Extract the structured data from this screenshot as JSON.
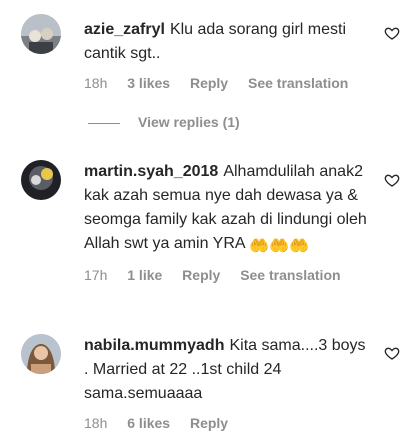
{
  "comments": [
    {
      "username": "azie_zafryl",
      "text": "Klu ada sorang girl mesti cantik sgt..",
      "time": "18h",
      "likes": "3 likes",
      "reply_label": "Reply",
      "translate_label": "See translation",
      "avatar_icon": "profile-photo"
    },
    {
      "username": "martin.syah_2018",
      "text": "Alhamdulilah anak2 kak azah semua nye dah dewasa ya & seomga family kak azah di lindungi oleh Allah swt ya amin YRA",
      "emoji": "🤲🤲🤲",
      "time": "17h",
      "likes": "1 like",
      "reply_label": "Reply",
      "translate_label": "See translation",
      "avatar_icon": "profile-photo"
    },
    {
      "username": "nabila.mummyadh",
      "text": "Kita sama....3 boys . Married at 22 ..1st child 24 sama.semuaaaa",
      "time": "18h",
      "likes": "6 likes",
      "reply_label": "Reply",
      "avatar_icon": "profile-photo"
    }
  ],
  "view_replies_label": "View replies (1)",
  "icons": {
    "like": "heart-outline-icon"
  },
  "colors": {
    "text": "#262626",
    "secondary": "#8e8e8e"
  }
}
